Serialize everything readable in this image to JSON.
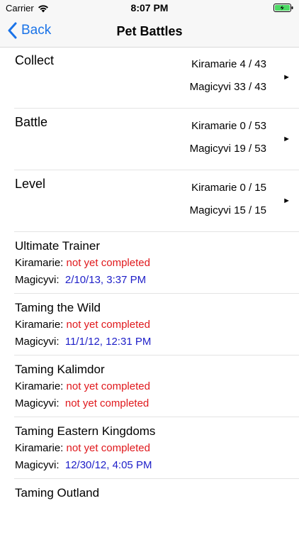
{
  "status_bar": {
    "carrier": "Carrier",
    "time": "8:07 PM",
    "icons": [
      "wifi-icon",
      "battery-charging-icon"
    ],
    "battery_color": "#4cd964"
  },
  "nav": {
    "back_label": "Back",
    "title": "Pet Battles",
    "accent_color": "#1a73e8"
  },
  "summaries": [
    {
      "title": "Collect",
      "line1": "Kiramarie 4 / 43",
      "line2": "Magicyvi 33 / 43"
    },
    {
      "title": "Battle",
      "line1": "Kiramarie 0 / 53",
      "line2": "Magicyvi 19 / 53"
    },
    {
      "title": "Level",
      "line1": "Kiramarie 0 / 15",
      "line2": "Magicyvi 15 / 15"
    }
  ],
  "achievements": [
    {
      "title": "Ultimate Trainer",
      "rows": [
        {
          "name": "Kiramarie:",
          "value": "not yet completed"
        },
        {
          "name": "Magicyvi:",
          "value": "2/10/13, 3:37 PM"
        }
      ]
    },
    {
      "title": "Taming the Wild",
      "rows": [
        {
          "name": "Kiramarie:",
          "value": "not yet completed"
        },
        {
          "name": "Magicyvi:",
          "value": "11/1/12, 12:31 PM"
        }
      ]
    },
    {
      "title": "Taming Kalimdor",
      "rows": [
        {
          "name": "Kiramarie:",
          "value": "not yet completed"
        },
        {
          "name": "Magicyvi:",
          "value": "not yet completed"
        }
      ]
    },
    {
      "title": "Taming Eastern Kingdoms",
      "rows": [
        {
          "name": "Kiramarie:",
          "value": "not yet completed"
        },
        {
          "name": "Magicyvi:",
          "value": "12/30/12, 4:05 PM"
        }
      ]
    },
    {
      "title": "Taming Outland",
      "rows": []
    }
  ],
  "colors": {
    "incomplete": "#e0181c",
    "completed": "#1d1ec8"
  }
}
